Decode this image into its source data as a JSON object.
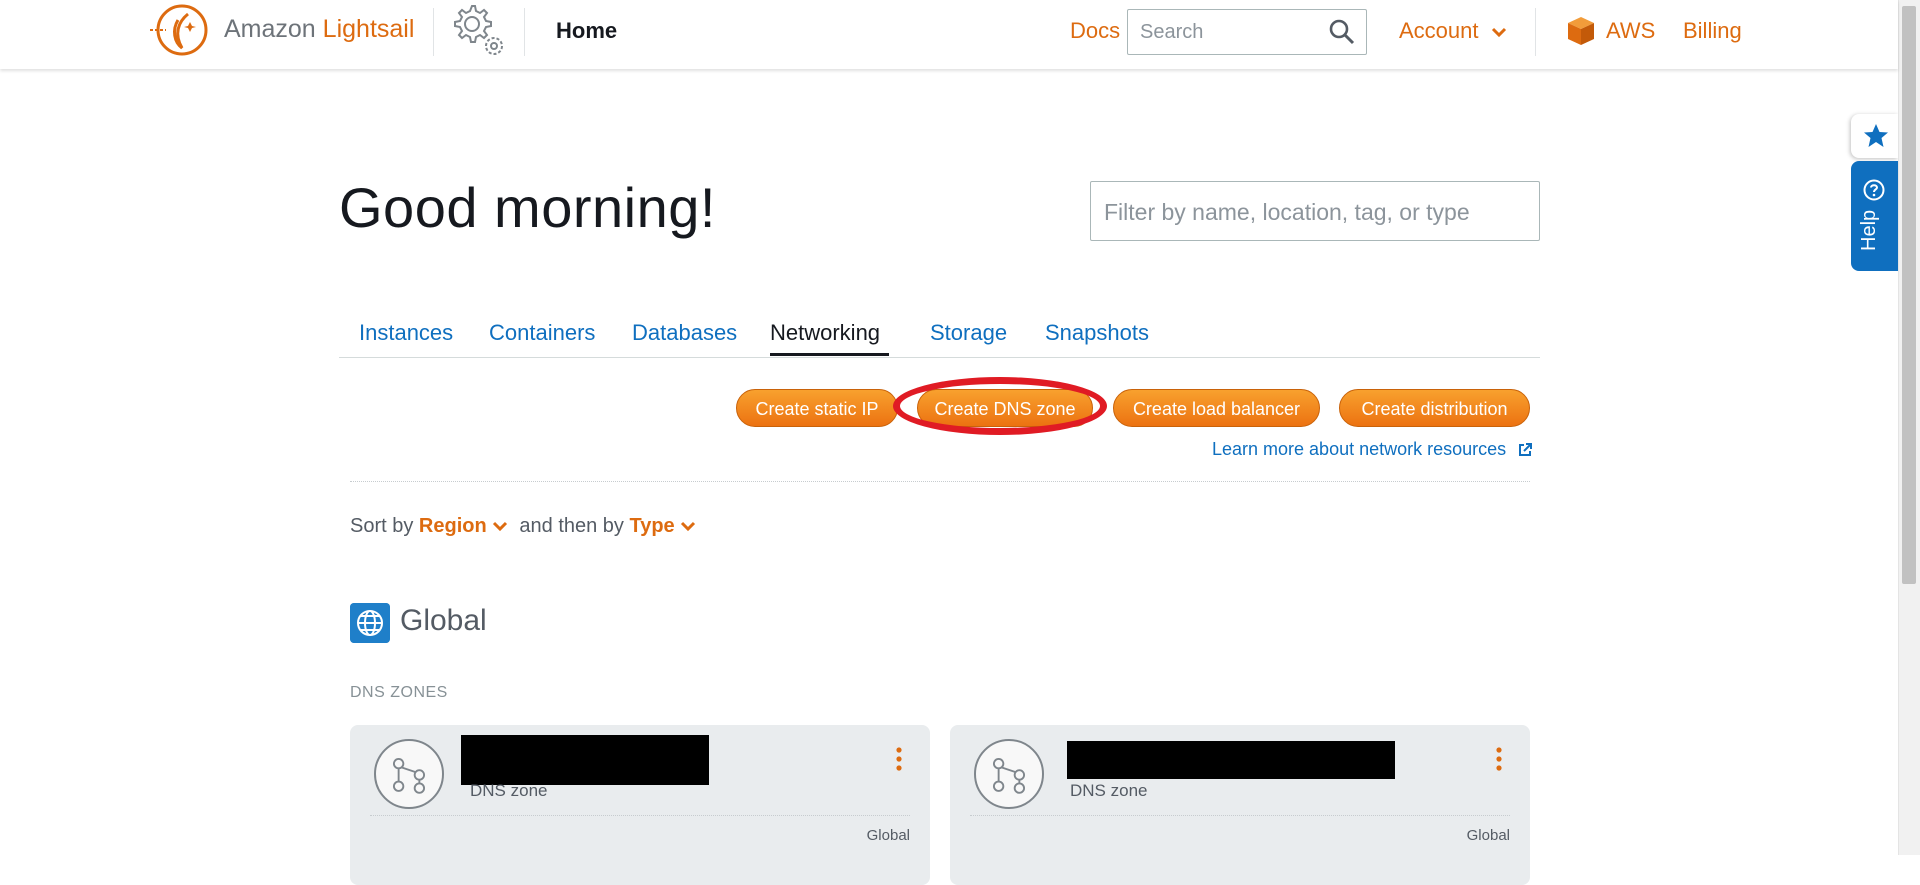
{
  "header": {
    "brand_prefix": "Amazon",
    "brand_name": "Lightsail",
    "home_label": "Home",
    "docs_label": "Docs",
    "search_placeholder": "Search",
    "account_label": "Account",
    "aws_label": "AWS",
    "billing_label": "Billing"
  },
  "main": {
    "greeting": "Good morning!",
    "filter_placeholder": "Filter by name, location, tag, or type",
    "tabs": [
      {
        "label": "Instances",
        "active": false
      },
      {
        "label": "Containers",
        "active": false
      },
      {
        "label": "Databases",
        "active": false
      },
      {
        "label": "Networking",
        "active": true
      },
      {
        "label": "Storage",
        "active": false
      },
      {
        "label": "Snapshots",
        "active": false
      }
    ],
    "actions": [
      {
        "label": "Create static IP"
      },
      {
        "label": "Create DNS zone",
        "highlighted": true
      },
      {
        "label": "Create load balancer"
      },
      {
        "label": "Create distribution"
      }
    ],
    "learn_more": "Learn more about network resources",
    "sort": {
      "sort_by_label": "Sort by",
      "sort_by_value": "Region",
      "then_by_label": "and then by",
      "then_by_value": "Type"
    },
    "region": {
      "title": "Global",
      "section_label": "DNS ZONES",
      "cards": [
        {
          "type_label": "DNS zone",
          "location": "Global"
        },
        {
          "type_label": "DNS zone",
          "location": "Global"
        }
      ]
    }
  },
  "side_tabs": {
    "help_label": "Help"
  },
  "colors": {
    "accent_orange": "#dd6b10",
    "link_blue": "#0f6fbf",
    "button_orange": "#ec7211",
    "highlight_red": "#e01b24"
  },
  "icons": [
    "lightsail-logo-icon",
    "gear-icon",
    "search-icon",
    "chevron-down-icon",
    "aws-cube-icon",
    "external-link-icon",
    "globe-icon",
    "dns-zone-icon",
    "kebab-menu-icon",
    "star-icon",
    "help-icon"
  ]
}
